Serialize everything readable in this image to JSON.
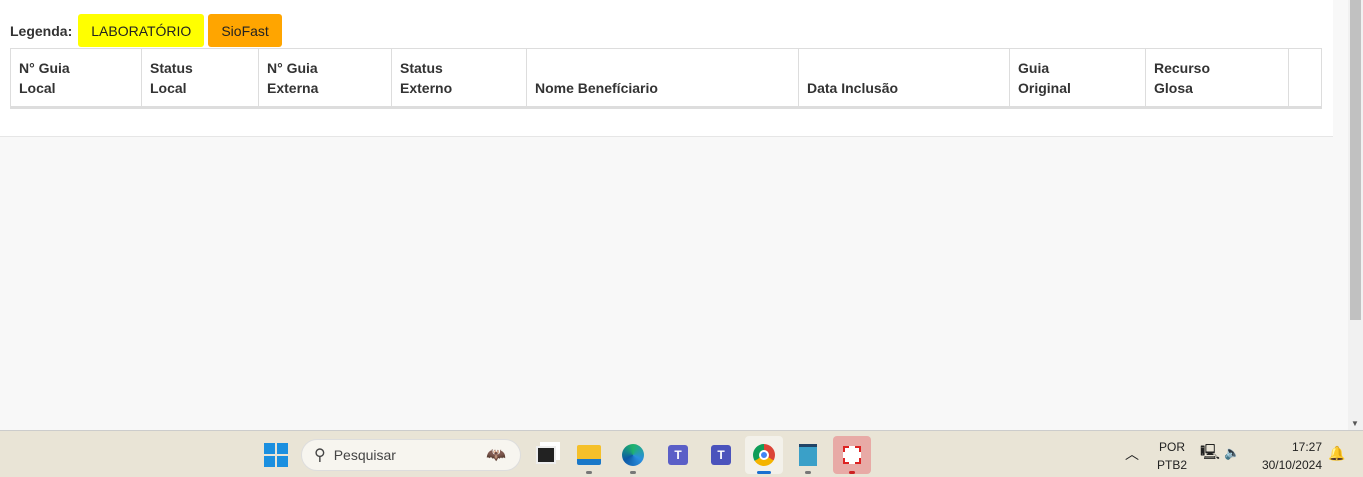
{
  "legend": {
    "label": "Legenda:",
    "items": [
      {
        "label": "LABORATÓRIO",
        "color": "#ffff00"
      },
      {
        "label": "SioFast",
        "color": "#ffa500"
      }
    ]
  },
  "table": {
    "headers": [
      [
        "N° Guia",
        "Local"
      ],
      [
        "Status",
        "Local"
      ],
      [
        "N° Guia",
        "Externa"
      ],
      [
        "Status",
        "Externo"
      ],
      [
        "",
        "Nome Benefíciario"
      ],
      [
        "",
        "Data Inclusão"
      ],
      [
        "Guia",
        "Original"
      ],
      [
        "Recurso",
        "Glosa"
      ],
      [
        "",
        ""
      ]
    ]
  },
  "taskbar": {
    "search_placeholder": "Pesquisar",
    "lang": "POR",
    "layout": "PTB2",
    "time": "17:27",
    "date": "30/10/2024"
  }
}
